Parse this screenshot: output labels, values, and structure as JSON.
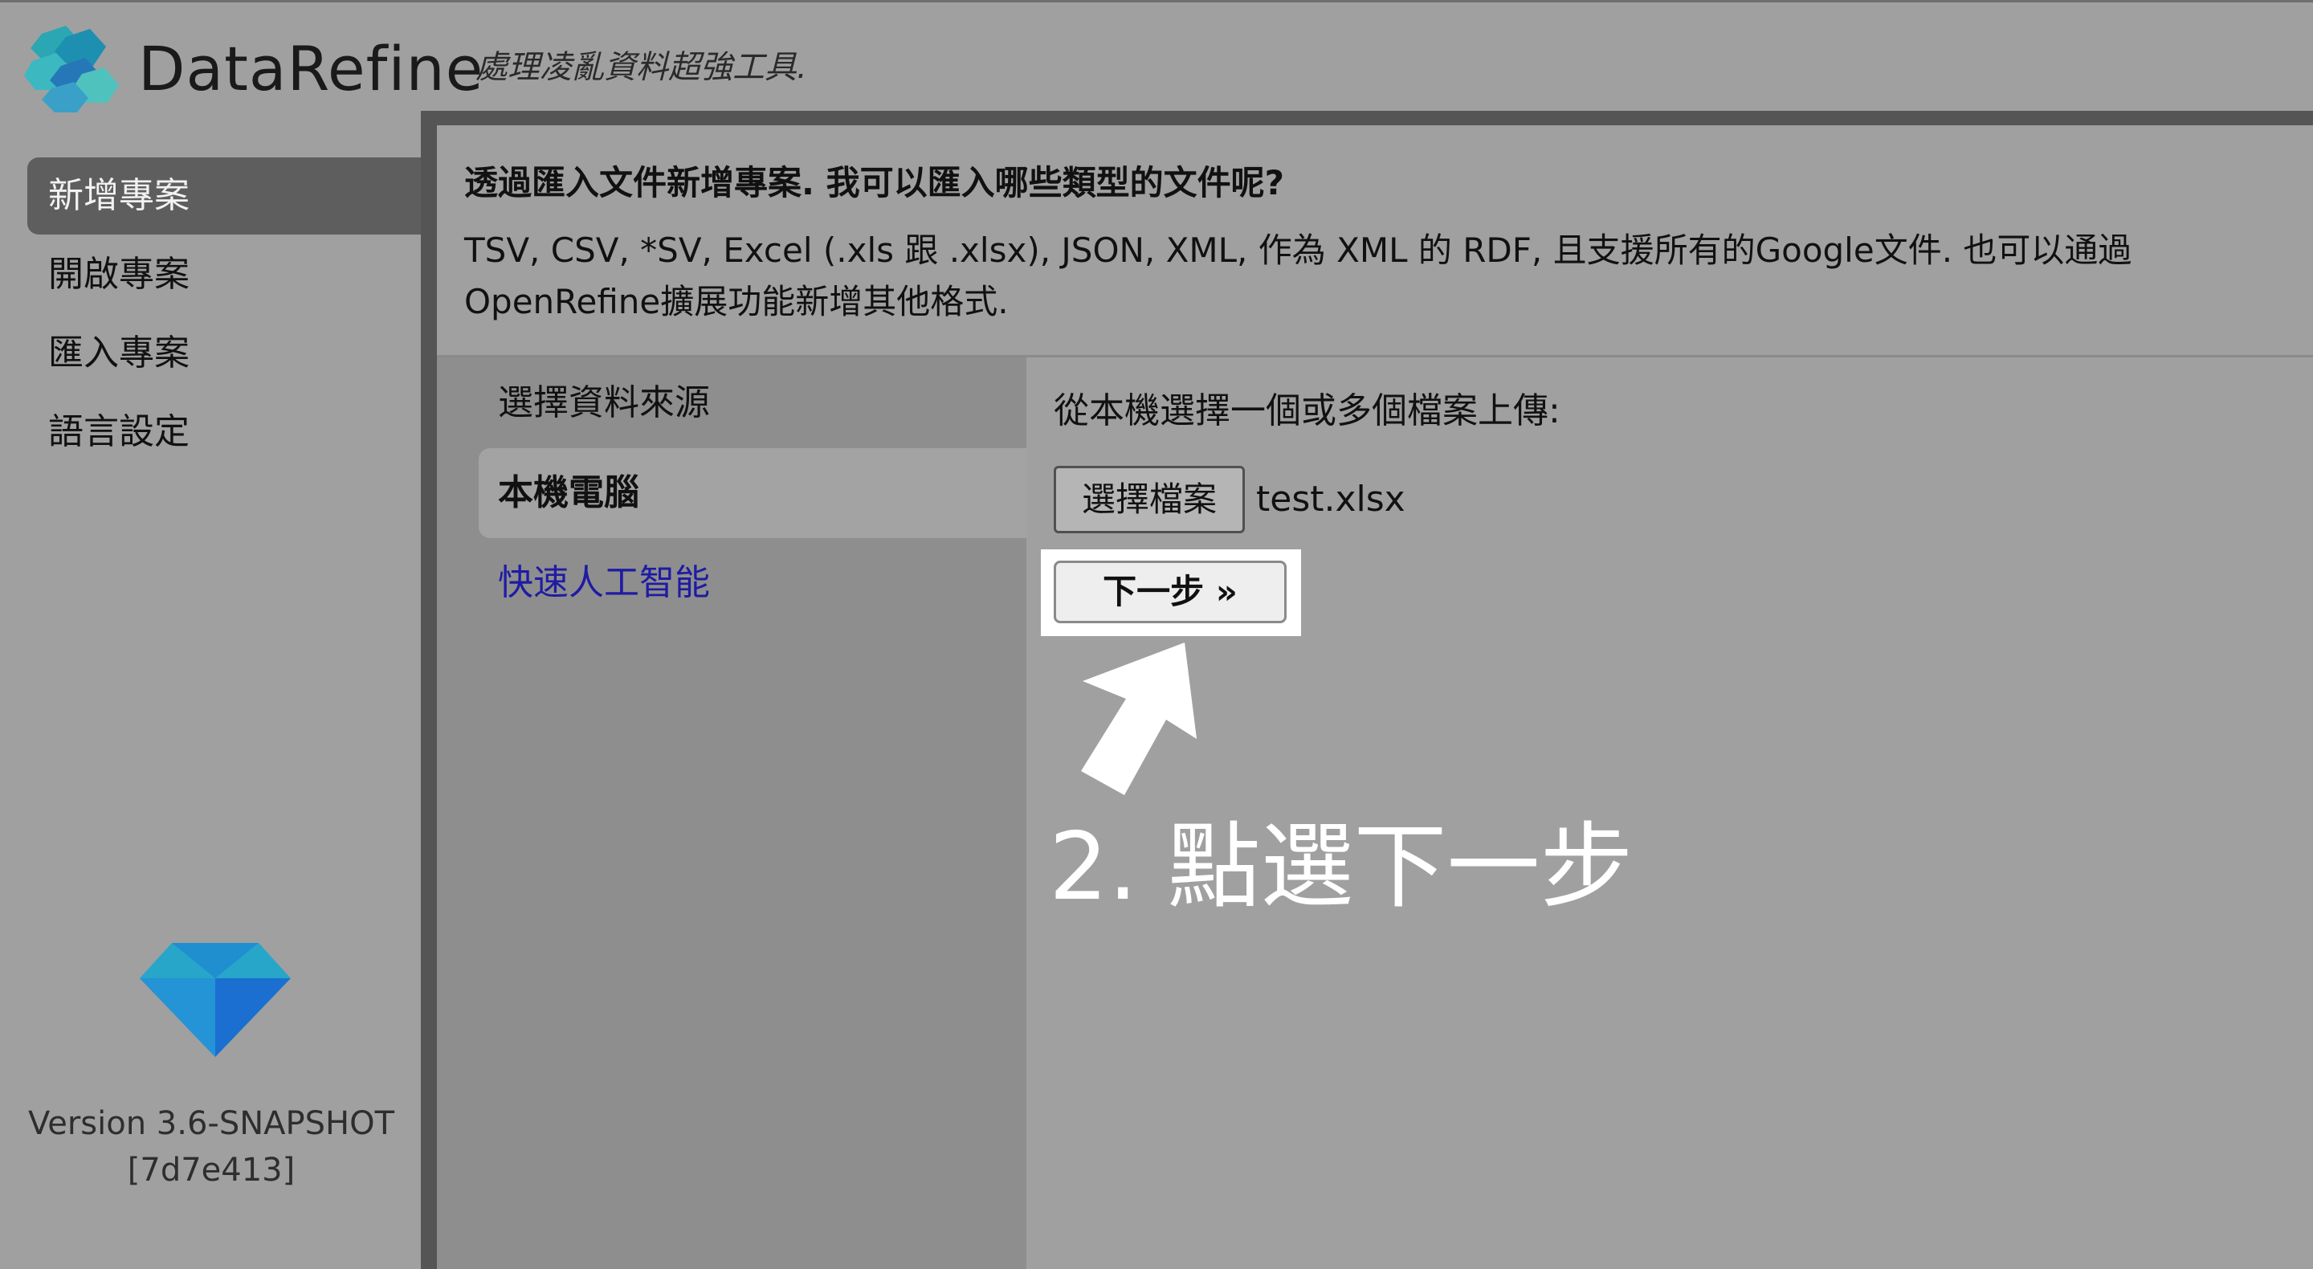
{
  "header": {
    "app_name": "DataRefine",
    "tagline": "處理凌亂資料超強工具."
  },
  "nav": {
    "items": [
      {
        "label": "新增專案",
        "active": true
      },
      {
        "label": "開啟專案",
        "active": false
      },
      {
        "label": "匯入專案",
        "active": false
      },
      {
        "label": "語言設定",
        "active": false
      }
    ]
  },
  "footer": {
    "version_line": "Version 3.6-SNAPSHOT",
    "build": "[7d7e413]"
  },
  "intro": {
    "title": "透過匯入文件新增專案. 我可以匯入哪些類型的文件呢?",
    "body": "TSV, CSV, *SV, Excel (.xls 跟 .xlsx), JSON, XML, 作為 XML 的 RDF, 且支援所有的Google文件. 也可以通過 OpenRefine擴展功能新增其他格式."
  },
  "sources": {
    "heading": "選擇資料來源",
    "items": [
      {
        "label": "本機電腦",
        "selected": true
      },
      {
        "label": "快速人工智能",
        "selected": false
      }
    ]
  },
  "upload": {
    "label": "從本機選擇一個或多個檔案上傳:",
    "choose_button": "選擇檔案",
    "file_name": "test.xlsx",
    "next_button": "下一步 »"
  },
  "annotation": {
    "text": "2. 點選下一步"
  },
  "colors": {
    "background": "#a0a0a0",
    "nav_active": "#5e5e5e",
    "source_column": "#8e8e8e",
    "link": "#1f1ba3",
    "annotation": "#ffffff"
  }
}
